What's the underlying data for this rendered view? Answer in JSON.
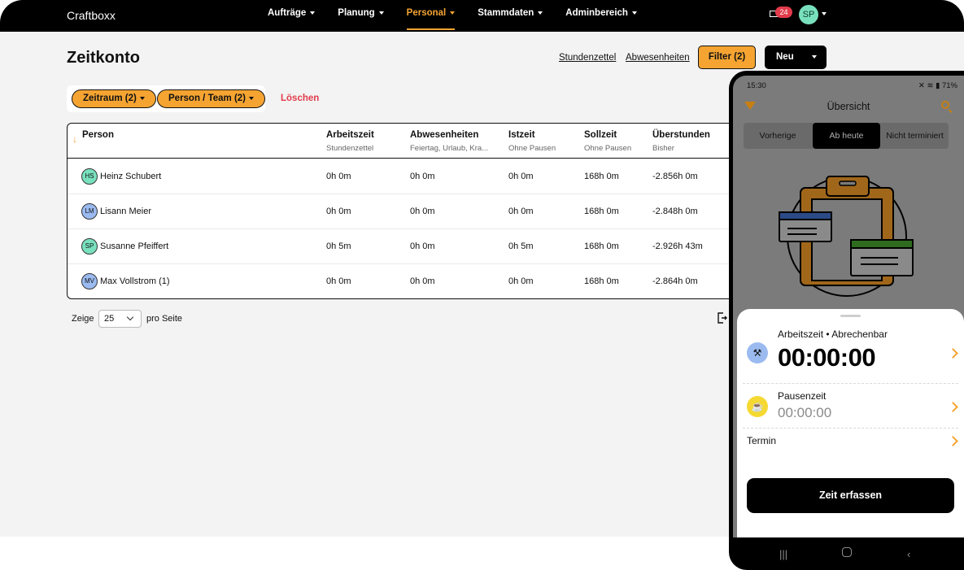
{
  "topbar": {
    "brand": "Craftboxx",
    "nav": [
      {
        "label": "Aufträge",
        "active": false
      },
      {
        "label": "Planung",
        "active": false
      },
      {
        "label": "Personal",
        "active": true
      },
      {
        "label": "Stammdaten",
        "active": false
      },
      {
        "label": "Adminbereich",
        "active": false
      }
    ],
    "mail_count": "24",
    "user_initials": "SP"
  },
  "page": {
    "title": "Zeitkonto",
    "actions": {
      "timesheet": "Stundenzettel",
      "absences": "Abwesenheiten",
      "filter": "Filter (2)",
      "new": "Neu"
    },
    "chips": {
      "period": "Zeitraum (2)",
      "person": "Person / Team (2)",
      "clear": "Löschen"
    }
  },
  "table": {
    "columns": [
      {
        "label": "Person",
        "sub": ""
      },
      {
        "label": "Arbeitszeit",
        "sub": "Stundenzettel"
      },
      {
        "label": "Abwesenheiten",
        "sub": "Feiertag, Urlaub, Kra..."
      },
      {
        "label": "Istzeit",
        "sub": "Ohne Pausen"
      },
      {
        "label": "Sollzeit",
        "sub": "Ohne Pausen"
      },
      {
        "label": "Überstunden",
        "sub": "Bisher"
      }
    ],
    "rows": [
      {
        "initials": "HS",
        "name": "Heinz Schubert",
        "work": "0h 0m",
        "absence": "0h 0m",
        "actual": "0h 0m",
        "target": "168h 0m",
        "overtime": "-2.856h 0m"
      },
      {
        "initials": "LM",
        "name": "Lisann Meier",
        "work": "0h 0m",
        "absence": "0h 0m",
        "actual": "0h 0m",
        "target": "168h 0m",
        "overtime": "-2.848h 0m"
      },
      {
        "initials": "SP",
        "name": "Susanne Pfeiffert",
        "work": "0h 5m",
        "absence": "0h 0m",
        "actual": "0h 5m",
        "target": "168h 0m",
        "overtime": "-2.926h 43m"
      },
      {
        "initials": "MV",
        "name": "Max Vollstrom (1)",
        "work": "0h 0m",
        "absence": "0h 0m",
        "actual": "0h 0m",
        "target": "168h 0m",
        "overtime": "-2.864h 0m"
      }
    ],
    "avatar_colors": {
      "HS": "#79e0bd",
      "LM": "#9bbbf0",
      "SP": "#79e0bd",
      "MV": "#9bbbf0"
    }
  },
  "pager": {
    "show": "Zeige",
    "per_page_value": "25",
    "per_page": "pro Seite"
  },
  "phone": {
    "time": "15:30",
    "battery": "71%",
    "title": "Übersicht",
    "segments": [
      "Vorherige",
      "Ab heute",
      "Nicht terminiert"
    ],
    "active_segment": "Ab heute",
    "work_label": "Arbeitszeit • Abrechenbar",
    "work_timer": "00:00:00",
    "pause_label": "Pausenzeit",
    "pause_timer": "00:00:00",
    "appointment_label": "Termin",
    "cta": "Zeit erfassen"
  },
  "colors": {
    "accent": "#f5a432",
    "danger": "#e23b4b",
    "dark": "#000000"
  }
}
